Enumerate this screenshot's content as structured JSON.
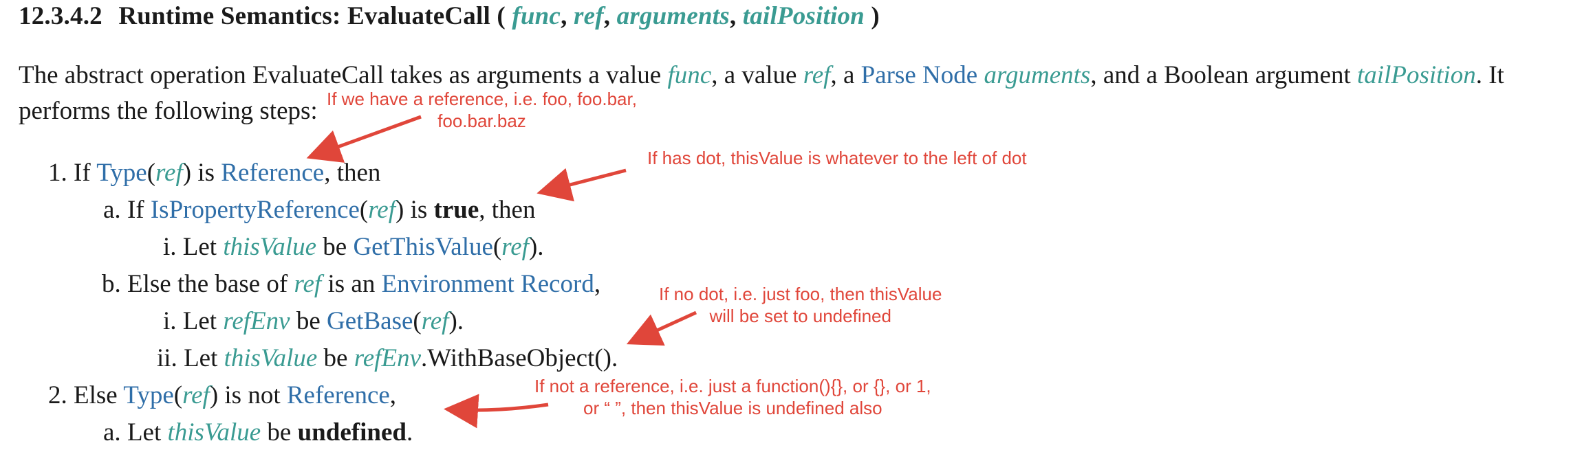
{
  "heading": {
    "section": "12.3.4.2",
    "title": "Runtime Semantics: EvaluateCall (",
    "p1": "func",
    "p2": "ref",
    "p3": "arguments",
    "p4": "tailPosition",
    "close": ")",
    "comma": ","
  },
  "intro": {
    "t1": "The abstract operation EvaluateCall takes as arguments a value ",
    "v1": "func",
    "t2": ", a value ",
    "v2": "ref",
    "t3": ", a ",
    "link1": "Parse Node",
    "t4": " ",
    "v3": "arguments",
    "t5": ", and a Boolean argument ",
    "v4": "tailPosition",
    "t6": ". It",
    "line2": "performs the following steps:"
  },
  "steps": {
    "s1": {
      "marker": "1.",
      "t1": "If ",
      "type": "Type",
      "open": "(",
      "ref": "ref",
      "close": ")",
      "t2": " is ",
      "reference": "Reference",
      "t3": ", then"
    },
    "s1a": {
      "marker": "a.",
      "t1": "If ",
      "isprop": "IsPropertyReference",
      "open": "(",
      "ref": "ref",
      "close": ")",
      "t2": " is ",
      "bold": "true",
      "t3": ", then"
    },
    "s1ai": {
      "marker": "i.",
      "t1": "Let ",
      "var": "thisValue",
      "t2": " be ",
      "fn": "GetThisValue",
      "open": "(",
      "ref": "ref",
      "close": ")."
    },
    "s1b": {
      "marker": "b.",
      "t1": "Else the base of ",
      "ref": "ref",
      "t2": " is an ",
      "link": "Environment Record",
      "t3": ","
    },
    "s1bi": {
      "marker": "i.",
      "t1": "Let ",
      "var": "refEnv",
      "t2": " be ",
      "fn": "GetBase",
      "open": "(",
      "ref": "ref",
      "close": ")."
    },
    "s1bii": {
      "marker": "ii.",
      "t1": "Let ",
      "var": "thisValue",
      "t2": " be ",
      "var2": "refEnv",
      "t3": ".WithBaseObject()."
    },
    "s2": {
      "marker": "2.",
      "t1": "Else ",
      "type": "Type",
      "open": "(",
      "ref": "ref",
      "close": ")",
      "t2": " is not ",
      "reference": "Reference",
      "t3": ","
    },
    "s2a": {
      "marker": "a.",
      "t1": "Let ",
      "var": "thisValue",
      "t2": " be ",
      "bold": "undefined",
      "t3": "."
    }
  },
  "annotations": {
    "n1_line1": "If we have a reference, i.e. foo, foo.bar,",
    "n1_line2": "foo.bar.baz",
    "n2": "If has dot, thisValue is whatever to the left of dot",
    "n3_line1": "If no dot, i.e. just foo, then thisValue",
    "n3_line2": "will be set to undefined",
    "n4_line1": "If not a reference, i.e. just a function(){}, or {}, or 1,",
    "n4_line2": "or “ ”, then thisValue is undefined also"
  },
  "colors": {
    "annotation": "#e0463a",
    "link": "#2f6ea8",
    "variable": "#3a9b92"
  }
}
